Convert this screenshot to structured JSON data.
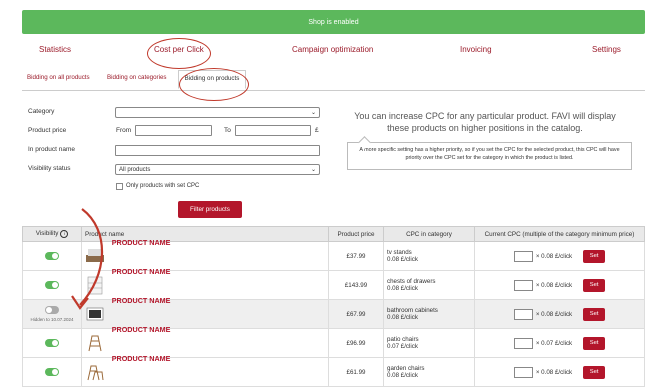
{
  "banner": "Shop is enabled",
  "top_nav": [
    "Statistics",
    "Cost per Click",
    "Campaign optimization",
    "Invoicing",
    "Settings"
  ],
  "sub_tabs": [
    "Bidding on all products",
    "Bidding on categories",
    "Bidding on products"
  ],
  "form": {
    "category_label": "Category",
    "price_label": "Product price",
    "from_label": "From",
    "to_label": "To",
    "currency": "£",
    "name_label": "In product name",
    "visibility_label": "Visibility status",
    "visibility_value": "All products",
    "only_cpc_label": "Only products with set CPC",
    "filter_button": "Filter products"
  },
  "info": {
    "title": "You can increase CPC for any particular product. FAVI will display these products on higher positions in the catalog.",
    "tooltip": "A more specific setting has a higher priority, so if you set the CPC for the selected product, this CPC will have priority over the CPC set for the category in which the product is listed."
  },
  "table": {
    "headers": [
      "Visibility",
      "Product name",
      "Product price",
      "CPC in category",
      "Current CPC (multiple of the category minimum price)"
    ],
    "rows": [
      {
        "visible": true,
        "name": "PRODUCT NAME",
        "price": "£37.99",
        "category": "tv stands",
        "cat_cpc": "0.08 £/click",
        "current": "× 0.08 £/click",
        "set": "Set"
      },
      {
        "visible": true,
        "name": "PRODUCT NAME",
        "price": "£143.99",
        "category": "chests of drawers",
        "cat_cpc": "0.08 £/click",
        "current": "× 0.08 £/click",
        "set": "Set"
      },
      {
        "visible": false,
        "hidden_note": "Hidden to 10.07.2024",
        "name": "PRODUCT NAME",
        "price": "£67.99",
        "category": "bathroom cabinets",
        "cat_cpc": "0.08 £/click",
        "current": "× 0.08 £/click",
        "set": "Set"
      },
      {
        "visible": true,
        "name": "PRODUCT NAME",
        "price": "£96.99",
        "category": "patio chairs",
        "cat_cpc": "0.07 £/click",
        "current": "× 0.07 £/click",
        "set": "Set"
      },
      {
        "visible": true,
        "name": "PRODUCT NAME",
        "price": "£61.99",
        "category": "garden chairs",
        "cat_cpc": "0.08 £/click",
        "current": "× 0.08 £/click",
        "set": "Set"
      }
    ]
  },
  "colors": {
    "brand": "#b3162b",
    "banner": "#5cb85c",
    "annotation": "#c0392b"
  }
}
